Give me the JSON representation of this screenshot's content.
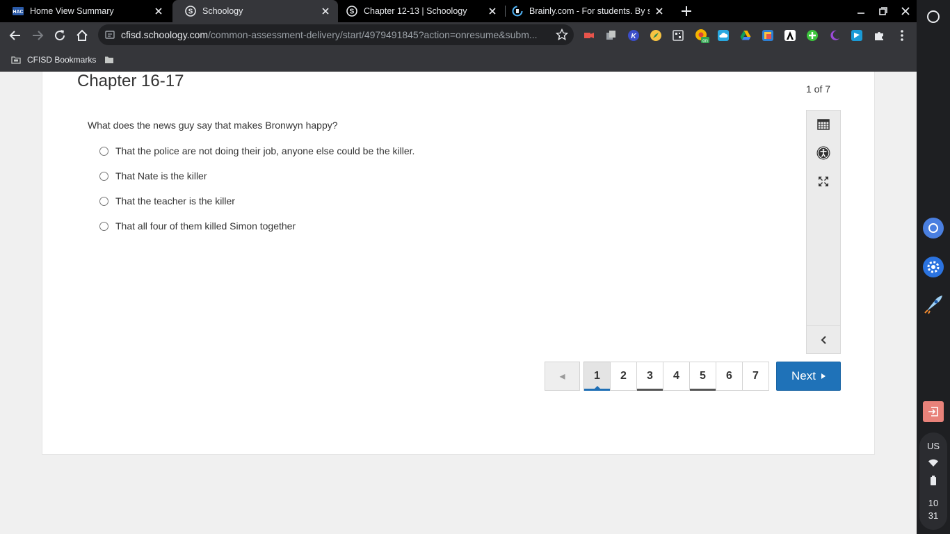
{
  "browser": {
    "tabs": [
      {
        "title": "Home View Summary",
        "favicon": "hac-icon",
        "active": false
      },
      {
        "title": "Schoology",
        "favicon": "schoology-icon",
        "active": true
      },
      {
        "title": "Chapter 12-13 | Schoology",
        "favicon": "schoology-icon",
        "active": false
      },
      {
        "title": "Brainly.com - For students. By st",
        "favicon": "brainly-icon",
        "active": false
      }
    ],
    "url_host": "cfisd.schoology.com",
    "url_path": "/common-assessment-delivery/start/4979491845?action=onresume&subm...",
    "bookmarks": [
      {
        "label": "CFISD Bookmarks",
        "icon": "bookmark-folder-icon"
      },
      {
        "label": "",
        "icon": "folder-icon"
      }
    ],
    "extensions": [
      "screencastify-icon",
      "copy-icon",
      "kami-icon",
      "compass-icon",
      "qr-icon",
      "chrome-on-icon",
      "cloud-icon",
      "google-drive-icon",
      "photo-icon",
      "adobe-icon",
      "green-plus-icon",
      "moon-icon",
      "flag-icon",
      "puzzle-icon"
    ]
  },
  "assessment": {
    "title": "Chapter 16-17",
    "counter": "1 of 7",
    "question": "What does the news guy say that makes Bronwyn happy?",
    "choices": [
      "That the police are not doing their job, anyone else could be the killer.",
      "That Nate is the killer",
      "That the teacher is the killer",
      "That all four of them killed Simon together"
    ],
    "tools": [
      "calculator-icon",
      "accessibility-icon",
      "fullscreen-icon"
    ],
    "pagination": {
      "prev_symbol": "◂",
      "pages": [
        "1",
        "2",
        "3",
        "4",
        "5",
        "6",
        "7"
      ],
      "current": "1",
      "next_label": "Next"
    }
  },
  "shelf": {
    "locale": "US",
    "time_hour": "10",
    "time_min": "31"
  },
  "colors": {
    "accent": "#1f72b8",
    "page_bg": "#f0f0f0",
    "chrome_dark": "#202124",
    "toolbar": "#35363a"
  }
}
